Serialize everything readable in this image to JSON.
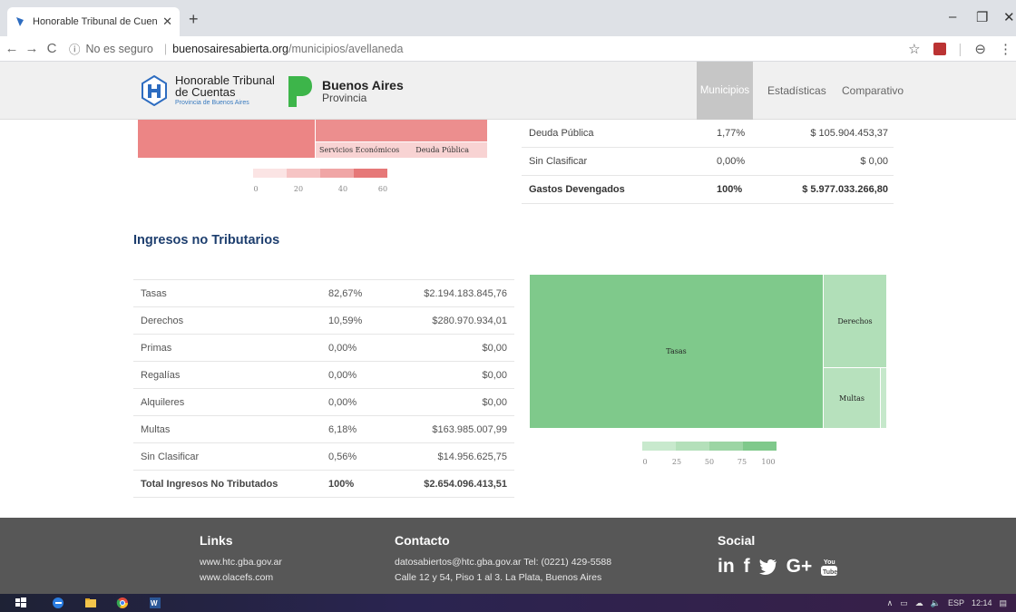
{
  "browser": {
    "tab_title": "Honorable Tribunal de Cuentas c",
    "tab_close": "✕",
    "new_tab": "+",
    "insecure_label": "No es seguro",
    "url_host": "buenosairesabierta.org",
    "url_path": "/municipios/avellaneda"
  },
  "header": {
    "htc_line1": "Honorable Tribunal",
    "htc_line2": "de Cuentas",
    "htc_line3": "Provincia de Buenos Aires",
    "ba_line1": "Buenos Aires",
    "ba_line2": "Provincia",
    "nav": {
      "municipios": "Municipios",
      "estadisticas": "Estadísticas",
      "comparativo": "Comparativo"
    }
  },
  "gastos_treemap": {
    "labels": [
      "Servicios Económicos",
      "Deuda Pública"
    ],
    "legend_ticks": [
      "0",
      "20",
      "40",
      "60"
    ],
    "color": "#ec8585"
  },
  "gastos_table": {
    "rows": [
      {
        "name": "Deuda Pública",
        "pct": "1,77%",
        "amount": "$ 105.904.453,37"
      },
      {
        "name": "Sin Clasificar",
        "pct": "0,00%",
        "amount": "$ 0,00"
      }
    ],
    "total": {
      "name": "Gastos Devengados",
      "pct": "100%",
      "amount": "$ 5.977.033.266,80"
    }
  },
  "ingresos": {
    "title": "Ingresos no Tributarios",
    "rows": [
      {
        "name": "Tasas",
        "pct": "82,67%",
        "amount": "$2.194.183.845,76"
      },
      {
        "name": "Derechos",
        "pct": "10,59%",
        "amount": "$280.970.934,01"
      },
      {
        "name": "Primas",
        "pct": "0,00%",
        "amount": "$0,00"
      },
      {
        "name": "Regalías",
        "pct": "0,00%",
        "amount": "$0,00"
      },
      {
        "name": "Alquileres",
        "pct": "0,00%",
        "amount": "$0,00"
      },
      {
        "name": "Multas",
        "pct": "6,18%",
        "amount": "$163.985.007,99"
      },
      {
        "name": "Sin Clasificar",
        "pct": "0,56%",
        "amount": "$14.956.625,75"
      }
    ],
    "total": {
      "name": "Total Ingresos No Tributados",
      "pct": "100%",
      "amount": "$2.654.096.413,51"
    }
  },
  "ingresos_treemap": {
    "labels": {
      "tasas": "Tasas",
      "derechos": "Derechos",
      "multas": "Multas"
    },
    "legend_ticks": [
      "0",
      "25",
      "50",
      "75",
      "100"
    ],
    "colors": {
      "dark": "#7fc98b",
      "light": "#b5e0bb"
    }
  },
  "footer": {
    "links_title": "Links",
    "link1": "www.htc.gba.gov.ar",
    "link2": "www.olacefs.com",
    "contact_title": "Contacto",
    "contact_line1": "datosabiertos@htc.gba.gov.ar Tel: (0221) 429-5588",
    "contact_line2": "Calle 12 y 54, Piso 1 al 3. La Plata, Buenos Aires",
    "social_title": "Social",
    "social_icons": [
      "linkedin-icon",
      "facebook-icon",
      "twitter-icon",
      "googleplus-icon",
      "youtube-icon"
    ]
  },
  "taskbar": {
    "lang": "ESP",
    "time": "12:14"
  }
}
